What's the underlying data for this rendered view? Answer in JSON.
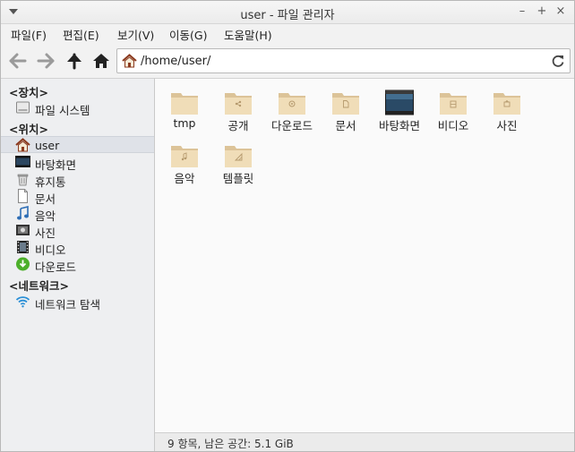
{
  "window": {
    "title": "user - 파일 관리자"
  },
  "menu": [
    "파일(F)",
    "편집(E)",
    "보기(V)",
    "이동(G)",
    "도움말(H)"
  ],
  "location": {
    "path": "/home/user/"
  },
  "sidebar": {
    "devices_header": "<장치>",
    "devices": [
      {
        "label": "파일 시스템",
        "icon": "drive-icon"
      }
    ],
    "places_header": "<위치>",
    "places": [
      {
        "label": "user",
        "icon": "home-icon",
        "selected": true
      },
      {
        "label": "바탕화면",
        "icon": "desktop-icon"
      },
      {
        "label": "휴지통",
        "icon": "trash-icon"
      },
      {
        "label": "문서",
        "icon": "document-icon"
      },
      {
        "label": "음악",
        "icon": "music-icon"
      },
      {
        "label": "사진",
        "icon": "pictures-icon"
      },
      {
        "label": "비디오",
        "icon": "video-icon"
      },
      {
        "label": "다운로드",
        "icon": "download-icon"
      }
    ],
    "network_header": "<네트워크>",
    "network": [
      {
        "label": "네트워크 탐색",
        "icon": "wifi-icon"
      }
    ]
  },
  "files": [
    {
      "name": "tmp",
      "icon": "folder-icon"
    },
    {
      "name": "공개",
      "icon": "folder-public-icon"
    },
    {
      "name": "다운로드",
      "icon": "folder-download-icon"
    },
    {
      "name": "문서",
      "icon": "folder-documents-icon"
    },
    {
      "name": "바탕화면",
      "icon": "folder-desktop-icon"
    },
    {
      "name": "비디오",
      "icon": "folder-videos-icon"
    },
    {
      "name": "사진",
      "icon": "folder-pictures-icon"
    },
    {
      "name": "음악",
      "icon": "folder-music-icon"
    },
    {
      "name": "템플릿",
      "icon": "folder-templates-icon"
    }
  ],
  "status": "9 항목, 남은 공간: 5.1 GiB",
  "colors": {
    "folder": "#f0ddb8",
    "folder_dark": "#dcc398",
    "selection": "#dfe2e8"
  }
}
